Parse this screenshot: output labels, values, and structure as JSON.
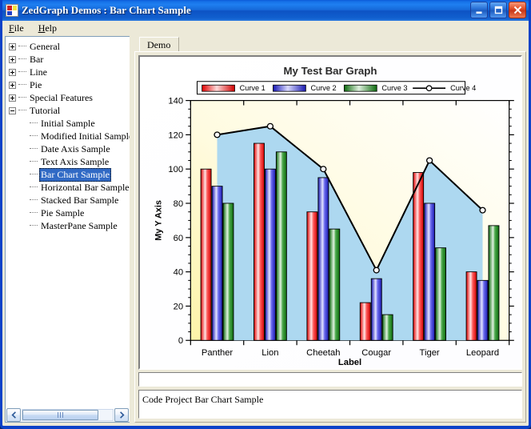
{
  "window": {
    "title": "ZedGraph Demos : Bar Chart Sample",
    "icon": "app-grid-icon",
    "buttons": {
      "minimize": "minimize-icon",
      "maximize": "maximize-icon",
      "close": "close-icon"
    }
  },
  "menu": {
    "items": [
      {
        "label": "File",
        "accel": "F"
      },
      {
        "label": "Help",
        "accel": "H"
      }
    ]
  },
  "tree": {
    "roots": [
      {
        "label": "General",
        "expanded": false
      },
      {
        "label": "Bar",
        "expanded": false
      },
      {
        "label": "Line",
        "expanded": false
      },
      {
        "label": "Pie",
        "expanded": false
      },
      {
        "label": "Special Features",
        "expanded": false
      },
      {
        "label": "Tutorial",
        "expanded": true
      }
    ],
    "children": [
      {
        "label": "Initial Sample",
        "selected": false
      },
      {
        "label": "Modified Initial Sample",
        "selected": false
      },
      {
        "label": "Date Axis Sample",
        "selected": false
      },
      {
        "label": "Text Axis Sample",
        "selected": false
      },
      {
        "label": "Bar Chart Sample",
        "selected": true
      },
      {
        "label": "Horizontal Bar Sample",
        "selected": false
      },
      {
        "label": "Stacked Bar Sample",
        "selected": false
      },
      {
        "label": "Pie Sample",
        "selected": false
      },
      {
        "label": "MasterPane Sample",
        "selected": false
      }
    ],
    "scroll": {
      "left_arrow": "chevron-left-icon",
      "right_arrow": "chevron-right-icon"
    }
  },
  "tabs": [
    {
      "label": "Demo",
      "active": true
    }
  ],
  "status": {
    "text": "Code Project Bar Chart Sample"
  },
  "info_field": {
    "value": ""
  },
  "chart_data": {
    "type": "bar",
    "title": "My Test Bar Graph",
    "xlabel": "Label",
    "ylabel": "My Y Axis",
    "categories": [
      "Panther",
      "Lion",
      "Cheetah",
      "Cougar",
      "Tiger",
      "Leopard"
    ],
    "ylim": [
      0,
      140
    ],
    "yticks": [
      0,
      20,
      40,
      60,
      80,
      100,
      120,
      140
    ],
    "grid": false,
    "legend_position": "top",
    "series": [
      {
        "name": "Curve 1",
        "type": "bar",
        "color": "#ff0000",
        "values": [
          100,
          115,
          75,
          22,
          98,
          40
        ]
      },
      {
        "name": "Curve 2",
        "type": "bar",
        "color": "#2020cc",
        "values": [
          90,
          100,
          95,
          36,
          80,
          35
        ]
      },
      {
        "name": "Curve 3",
        "type": "bar",
        "color": "#178017",
        "values": [
          80,
          110,
          65,
          15,
          54,
          67
        ]
      },
      {
        "name": "Curve 4",
        "type": "line",
        "color": "#000000",
        "fill": "#add8f0",
        "marker": "circle",
        "values": [
          120,
          125,
          100,
          41,
          105,
          76
        ]
      }
    ],
    "pane_fill": "#fffffb",
    "chart_fill_start": "#fff9c4",
    "chart_fill_end": "#ffffff"
  }
}
